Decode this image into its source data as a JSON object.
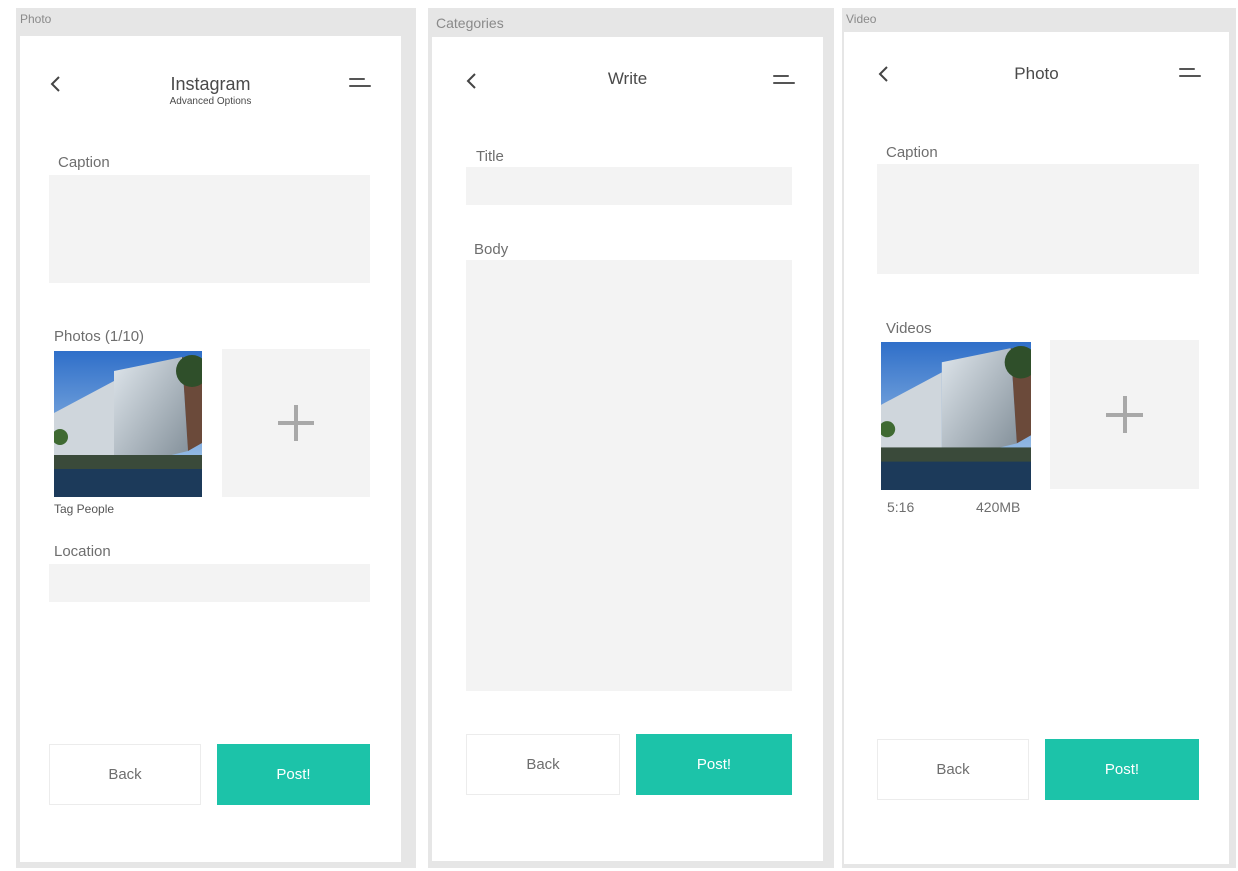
{
  "screens": {
    "photo": {
      "frame_label": "Photo",
      "title": "Instagram",
      "subtitle": "Advanced Options",
      "caption_label": "Caption",
      "photos_label": "Photos (1/10)",
      "tag_people_label": "Tag People",
      "location_label": "Location",
      "back_label": "Back",
      "post_label": "Post!"
    },
    "categories": {
      "frame_label": "Categories",
      "title": "Write",
      "title_label": "Title",
      "body_label": "Body",
      "back_label": "Back",
      "post_label": "Post!"
    },
    "video": {
      "frame_label": "Video",
      "title": "Photo",
      "caption_label": "Caption",
      "videos_label": "Videos",
      "video_duration": "5:16",
      "video_size": "420MB",
      "back_label": "Back",
      "post_label": "Post!"
    }
  },
  "icons": {
    "back": "chevron-left-icon",
    "menu": "menu-lines-icon",
    "add": "plus-icon"
  },
  "colors": {
    "accent": "#1cc3a9",
    "field_background": "#f3f3f3",
    "frame_background": "#e6e6e6"
  }
}
